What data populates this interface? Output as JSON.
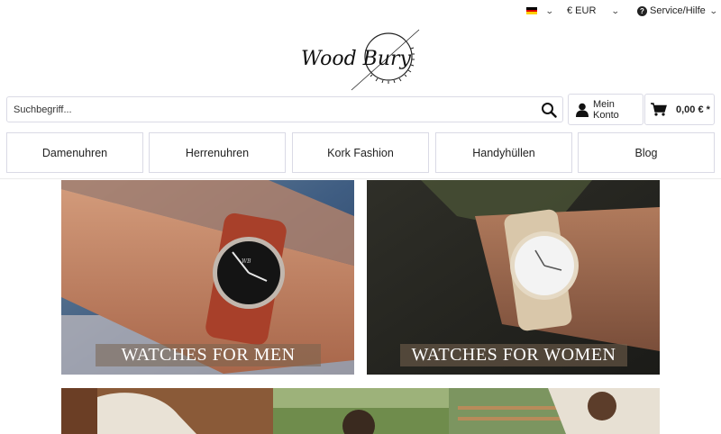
{
  "topbar": {
    "language_flag": "german-flag",
    "currency": "€ EUR",
    "service": "Service/Hilfe"
  },
  "logo": {
    "brand_text": "Wood Bury"
  },
  "search": {
    "placeholder": "Suchbegriff..."
  },
  "account": {
    "label": "Mein Konto"
  },
  "cart": {
    "total": "0,00 € *"
  },
  "nav": {
    "items": [
      {
        "label": "Damenuhren"
      },
      {
        "label": "Herrenuhren"
      },
      {
        "label": "Kork Fashion"
      },
      {
        "label": "Handyhüllen"
      },
      {
        "label": "Blog"
      }
    ]
  },
  "banners": [
    {
      "label": "WATCHES FOR MEN"
    },
    {
      "label": "WATCHES FOR WOMEN"
    }
  ],
  "colors": {
    "border": "#dadae5",
    "text": "#1f1f1f",
    "banner_label_bg": "#786450"
  }
}
